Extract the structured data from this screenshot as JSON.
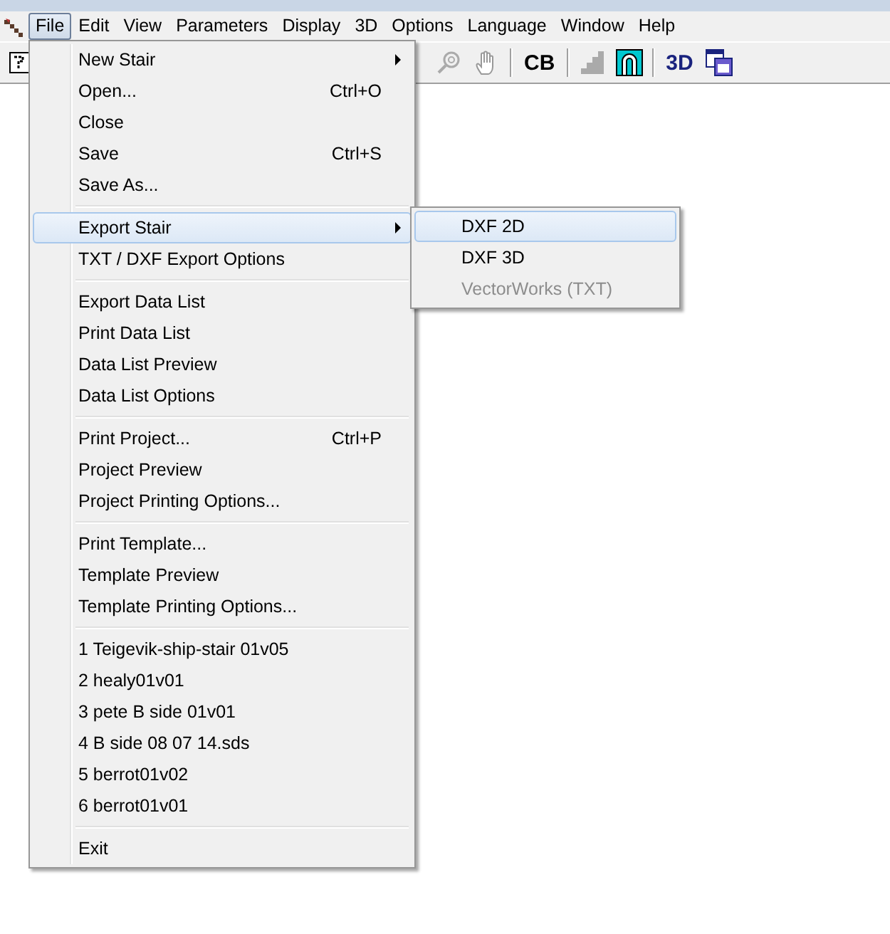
{
  "menubar": [
    {
      "label": "File",
      "selected": true
    },
    {
      "label": "Edit",
      "selected": false
    },
    {
      "label": "View",
      "selected": false
    },
    {
      "label": "Parameters",
      "selected": false
    },
    {
      "label": "Display",
      "selected": false
    },
    {
      "label": "3D",
      "selected": false
    },
    {
      "label": "Options",
      "selected": false
    },
    {
      "label": "Language",
      "selected": false
    },
    {
      "label": "Window",
      "selected": false
    },
    {
      "label": "Help",
      "selected": false
    }
  ],
  "toolbar": [
    {
      "kind": "magnifier"
    },
    {
      "kind": "hand"
    },
    {
      "kind": "separator"
    },
    {
      "kind": "text",
      "label": "CB"
    },
    {
      "kind": "separator"
    },
    {
      "kind": "stair"
    },
    {
      "kind": "arch"
    },
    {
      "kind": "separator"
    },
    {
      "kind": "text",
      "label": "3D"
    },
    {
      "kind": "view2d"
    }
  ],
  "file_menu": [
    [
      {
        "label": "New Stair",
        "submenu": true,
        "selected": false
      },
      {
        "label": "Open...",
        "shortcut": "Ctrl+O",
        "submenu": false,
        "selected": false
      },
      {
        "label": "Close",
        "submenu": false,
        "selected": false
      },
      {
        "label": "Save",
        "shortcut": "Ctrl+S",
        "submenu": false,
        "selected": false
      },
      {
        "label": "Save As...",
        "submenu": false,
        "selected": false
      }
    ],
    [
      {
        "label": "Export Stair",
        "submenu": true,
        "selected": true
      },
      {
        "label": "TXT / DXF Export Options",
        "submenu": false,
        "selected": false
      }
    ],
    [
      {
        "label": "Export Data List",
        "submenu": false,
        "selected": false
      },
      {
        "label": "Print Data List",
        "submenu": false,
        "selected": false
      },
      {
        "label": "Data List Preview",
        "submenu": false,
        "selected": false
      },
      {
        "label": "Data List Options",
        "submenu": false,
        "selected": false
      }
    ],
    [
      {
        "label": "Print Project...",
        "shortcut": "Ctrl+P",
        "submenu": false,
        "selected": false
      },
      {
        "label": "Project Preview",
        "submenu": false,
        "selected": false
      },
      {
        "label": "Project Printing Options...",
        "submenu": false,
        "selected": false
      }
    ],
    [
      {
        "label": "Print Template...",
        "submenu": false,
        "selected": false
      },
      {
        "label": "Template Preview",
        "submenu": false,
        "selected": false
      },
      {
        "label": "Template Printing Options...",
        "submenu": false,
        "selected": false
      }
    ],
    [
      {
        "label": "1 Teigevik-ship-stair 01v05",
        "submenu": false,
        "selected": false
      },
      {
        "label": "2 healy01v01",
        "submenu": false,
        "selected": false
      },
      {
        "label": "3 pete B side 01v01",
        "submenu": false,
        "selected": false
      },
      {
        "label": "4 B side 08 07 14.sds",
        "submenu": false,
        "selected": false
      },
      {
        "label": "5 berrot01v02",
        "submenu": false,
        "selected": false
      },
      {
        "label": "6 berrot01v01",
        "submenu": false,
        "selected": false
      }
    ],
    [
      {
        "label": "Exit",
        "submenu": false,
        "selected": false
      }
    ]
  ],
  "export_submenu": [
    {
      "label": "DXF 2D",
      "selected": true,
      "disabled": false
    },
    {
      "label": "DXF 3D",
      "selected": false,
      "disabled": false
    },
    {
      "label": "VectorWorks (TXT)",
      "selected": false,
      "disabled": true
    }
  ]
}
